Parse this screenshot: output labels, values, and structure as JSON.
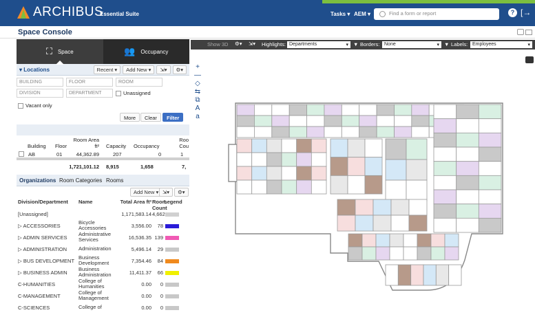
{
  "header": {
    "brand": "ARCHIBUS",
    "suite": "Essential Suite",
    "nav_tasks": "Tasks ▾",
    "nav_aem": "AEM ▾",
    "search_placeholder": "Find a form or report",
    "help": "?",
    "logout": "[→"
  },
  "page": {
    "title": "Space Console"
  },
  "modes": [
    {
      "label": "Space",
      "icon": "space-icon"
    },
    {
      "label": "Occupancy",
      "icon": "occupancy-icon"
    }
  ],
  "locations": {
    "title": "▾ Locations",
    "recent": "Recent ▾",
    "add_new": "Add New ▾",
    "fields": {
      "building": "BUILDING",
      "floor": "FLOOR",
      "room": "ROOM",
      "division": "DIVISION",
      "department": "DEPARTMENT",
      "unassigned": "Unassigned",
      "vacant_only": "Vacant only"
    },
    "more": "More",
    "clear": "Clear",
    "filter": "Filter",
    "columns": [
      "Building",
      "Floor",
      "Room Area ft²",
      "Capacity",
      "Occupancy",
      "Roo Cou"
    ],
    "row": [
      "AB",
      "01",
      "44,362.89",
      "207",
      "0",
      "1"
    ],
    "totals": [
      "1,721,101.12",
      "8,915",
      "1,658",
      "7,"
    ]
  },
  "org_tabs": [
    "Organizations",
    "Room Categories",
    "Rooms"
  ],
  "organizations": {
    "add_new": "Add New ▾",
    "columns": [
      "Division/Department",
      "Name",
      "Total Area ft²",
      "Room Count",
      "Legend"
    ],
    "rows": [
      {
        "div": "[Unassigned]",
        "name": "",
        "area": "1,171,583.14",
        "count": "4,662",
        "color": "#d0d0d0"
      },
      {
        "div": "▷ ACCESSORIES",
        "name": "Bicycle Accessories",
        "area": "3,556.00",
        "count": "78",
        "color": "#2a1bd8"
      },
      {
        "div": "▷ ADMIN SERVICES",
        "name": "Administrative Services",
        "area": "16,536.35",
        "count": "139",
        "color": "#f05ab4"
      },
      {
        "div": "▷ ADMINISTRATION",
        "name": "Administration",
        "area": "5,496.14",
        "count": "29",
        "color": "#c8c8c8"
      },
      {
        "div": "▷ BUS DEVELOPMENT",
        "name": "Business Development",
        "area": "7,354.46",
        "count": "84",
        "color": "#f08a1e"
      },
      {
        "div": "▷ BUSINESS ADMIN",
        "name": "Business Administration",
        "area": "11,411.37",
        "count": "66",
        "color": "#f0f000"
      },
      {
        "div": "C-HUMANITIES",
        "name": "College of Humanities",
        "area": "0.00",
        "count": "0",
        "color": "#c8c8c8"
      },
      {
        "div": "C-MANAGEMENT",
        "name": "College of Management",
        "area": "0.00",
        "count": "0",
        "color": "#c8c8c8"
      },
      {
        "div": "C-SCIENCES",
        "name": "College of",
        "area": "0.00",
        "count": "0",
        "color": "#c8c8c8"
      }
    ]
  },
  "mapbar": {
    "show3d": "Show 3D",
    "highlights_label": "Highlights:",
    "highlights_value": "Departments",
    "borders_label": "Borders:",
    "borders_value": "None",
    "labels_label": "Labels:",
    "labels_value": "Employees"
  },
  "map_tools": [
    "+",
    "—",
    "◇",
    "⇆",
    "⧉",
    "A",
    "a"
  ]
}
